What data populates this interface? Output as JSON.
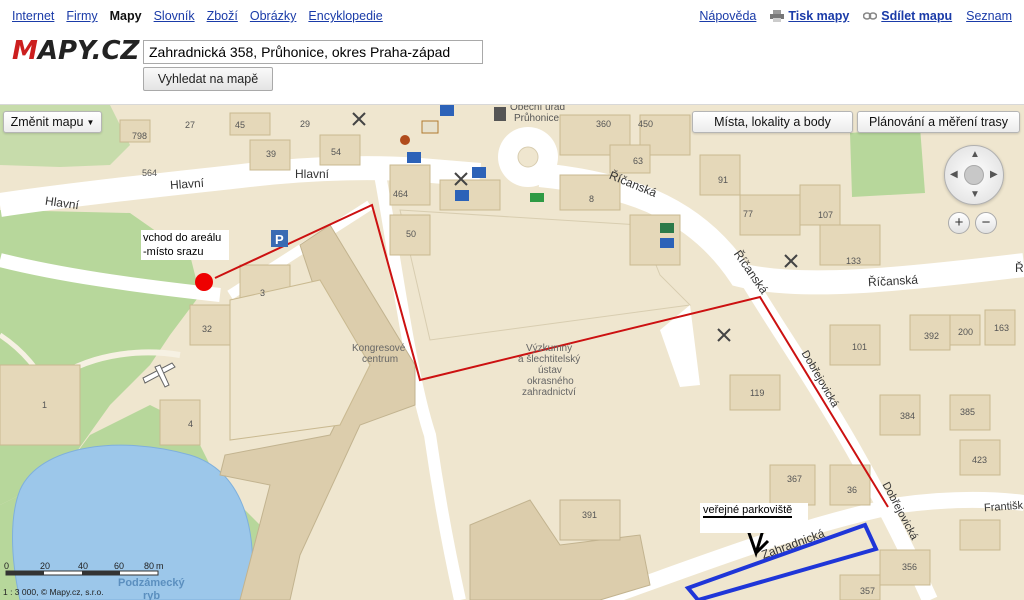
{
  "nav": {
    "left": [
      "Internet",
      "Firmy",
      "Mapy",
      "Slovník",
      "Zboží",
      "Obrázky",
      "Encyklopedie"
    ],
    "active": "Mapy",
    "right": {
      "help": "Nápověda",
      "print": "Tisk mapy",
      "share": "Sdílet mapu",
      "seznam": "Seznam"
    }
  },
  "logo": {
    "part1": "M",
    "part2": "APY.CZ"
  },
  "search": {
    "value": "Zahradnická 358, Průhonice, okres Praha-západ",
    "button": "Vyhledat na mapě"
  },
  "map": {
    "buttons": {
      "change": "Změnit mapu",
      "places": "Místa, lokality a body",
      "plan": "Plánování a měření trasy"
    },
    "streets": {
      "hlavni1": "Hlavní",
      "hlavni2": "Hlavní",
      "hlavni3": "Hlavní",
      "ricanska1": "Říčanská",
      "ricanska2": "Říčanská",
      "ricanska3": "Říčanská",
      "ricanska4": "Ř",
      "dobrejovicka1": "Dobřejovická",
      "dobrejovicka2": "Dobřejovická",
      "zahradnicka": "Zahradnická",
      "frantiska": "Františk"
    },
    "places": {
      "kongres1": "Kongresové",
      "kongres2": "centrum",
      "ustav": [
        "Výzkumný",
        "a šlechtitelský",
        "ústav",
        "okrasného",
        "zahradnictví"
      ],
      "obecni1": "Obecní úřad",
      "obecni2": "Průhonice",
      "podzamecky1": "Podzámecký",
      "podzamecky2": "ryb"
    },
    "numbers": [
      "798",
      "564",
      "27",
      "45",
      "29",
      "39",
      "54",
      "360",
      "450",
      "63",
      "91",
      "77",
      "107",
      "133",
      "464",
      "50",
      "8",
      "3",
      "32",
      "1",
      "4",
      "392",
      "200",
      "163",
      "101",
      "119",
      "384",
      "385",
      "423",
      "367",
      "36",
      "391",
      "356",
      "357"
    ],
    "notes": {
      "entrance1": "vchod do areálu",
      "entrance2": "-místo srazu",
      "parking": "veřejné parkoviště"
    },
    "scale": {
      "ticks": [
        "0",
        "20",
        "40",
        "60",
        "80"
      ],
      "unit": "m",
      "ratio": "1 : 3 000,"
    },
    "copyright": "© Mapy.cz, s.r.o."
  },
  "colors": {
    "route": "#cc1111",
    "parking_box": "#1f36d8",
    "park": "#b7d79b",
    "water": "#9cc7ea",
    "road": "#ffffff",
    "building": "#e5d8b9",
    "land": "#efe6cf"
  }
}
